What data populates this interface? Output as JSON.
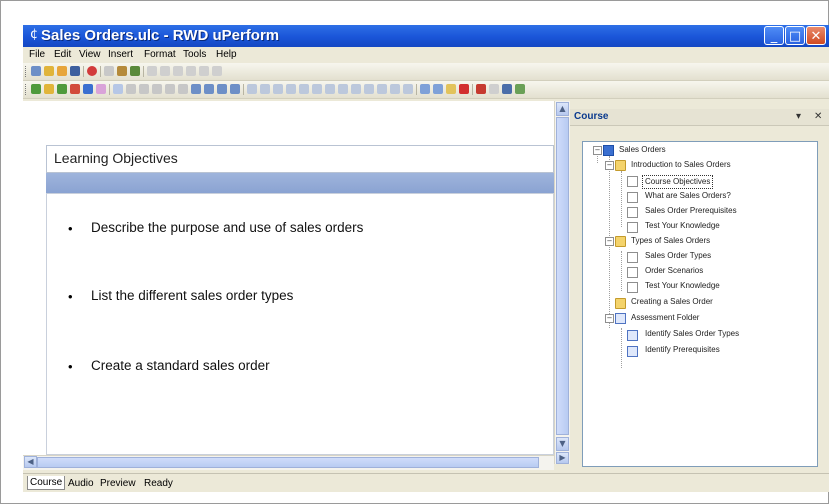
{
  "window": {
    "title": "Sales Orders.ulc - RWD uPerform"
  },
  "menu": [
    "File",
    "Edit",
    "View",
    "Insert",
    "Format",
    "Tools",
    "Help"
  ],
  "toolbar_icons": {
    "row1": [
      "find-icon",
      "new-folder-icon",
      "open-icon",
      "save-icon",
      "record-icon",
      "search-icon",
      "import-icon",
      "export-icon",
      "cut-icon",
      "copy-icon",
      "paste-icon",
      "undo-icon",
      "redo-icon",
      "settings-icon"
    ],
    "row2": [
      "insert-icon",
      "add-page-icon",
      "add-section-icon",
      "add-test-icon",
      "add-question-icon",
      "link-icon",
      "properties-icon",
      "bold-icon",
      "italic-icon",
      "underline-icon",
      "align-left-icon",
      "align-center-icon",
      "align-right-icon",
      "bullets-icon",
      "numbering-icon",
      "indent-icon",
      "outdent-icon",
      "cut-icon",
      "copy-icon",
      "paste-icon",
      "delete-icon",
      "undo-icon",
      "redo-icon",
      "find-icon",
      "spell-icon"
    ]
  },
  "document": {
    "heading": "Learning Objectives",
    "objectives": [
      "Describe the purpose and use of sales orders",
      "List the different sales order types",
      "Create a standard sales order"
    ]
  },
  "status_bar": {
    "tabs": [
      "Course",
      "Audio",
      "Preview"
    ],
    "active_tab": "Course",
    "status_text": "Ready"
  },
  "course_pane": {
    "title": "Course",
    "tree": [
      {
        "label": "Sales Orders",
        "level": 0,
        "icon": "book-icon",
        "expander": "−"
      },
      {
        "label": "Introduction to Sales Orders",
        "level": 1,
        "icon": "folder-open-icon",
        "expander": "−"
      },
      {
        "label": "Course Objectives",
        "level": 2,
        "icon": "page-icon",
        "selected": true
      },
      {
        "label": "What are Sales Orders?",
        "level": 2,
        "icon": "page-icon"
      },
      {
        "label": "Sales Order Prerequisites",
        "level": 2,
        "icon": "page-icon"
      },
      {
        "label": "Test Your Knowledge",
        "level": 2,
        "icon": "page-icon"
      },
      {
        "label": "Types of Sales Orders",
        "level": 1,
        "icon": "folder-open-icon",
        "expander": "−"
      },
      {
        "label": "Sales Order Types",
        "level": 2,
        "icon": "page-icon"
      },
      {
        "label": "Order Scenarios",
        "level": 2,
        "icon": "page-icon"
      },
      {
        "label": "Test Your Knowledge",
        "level": 2,
        "icon": "page-icon"
      },
      {
        "label": "Creating a Sales Order",
        "level": 1,
        "icon": "folder-open-icon"
      },
      {
        "label": "Assessment Folder",
        "level": 1,
        "icon": "assessment-icon",
        "expander": "−"
      },
      {
        "label": "Identify Sales Order Types",
        "level": 2,
        "icon": "assessment-item-icon"
      },
      {
        "label": "Identify Prerequisites",
        "level": 2,
        "icon": "assessment-item-icon"
      }
    ]
  },
  "colors": {
    "titlebar": "#1a55d8",
    "band": "#8aa3d2",
    "pane_title": "#0b3a8e"
  }
}
